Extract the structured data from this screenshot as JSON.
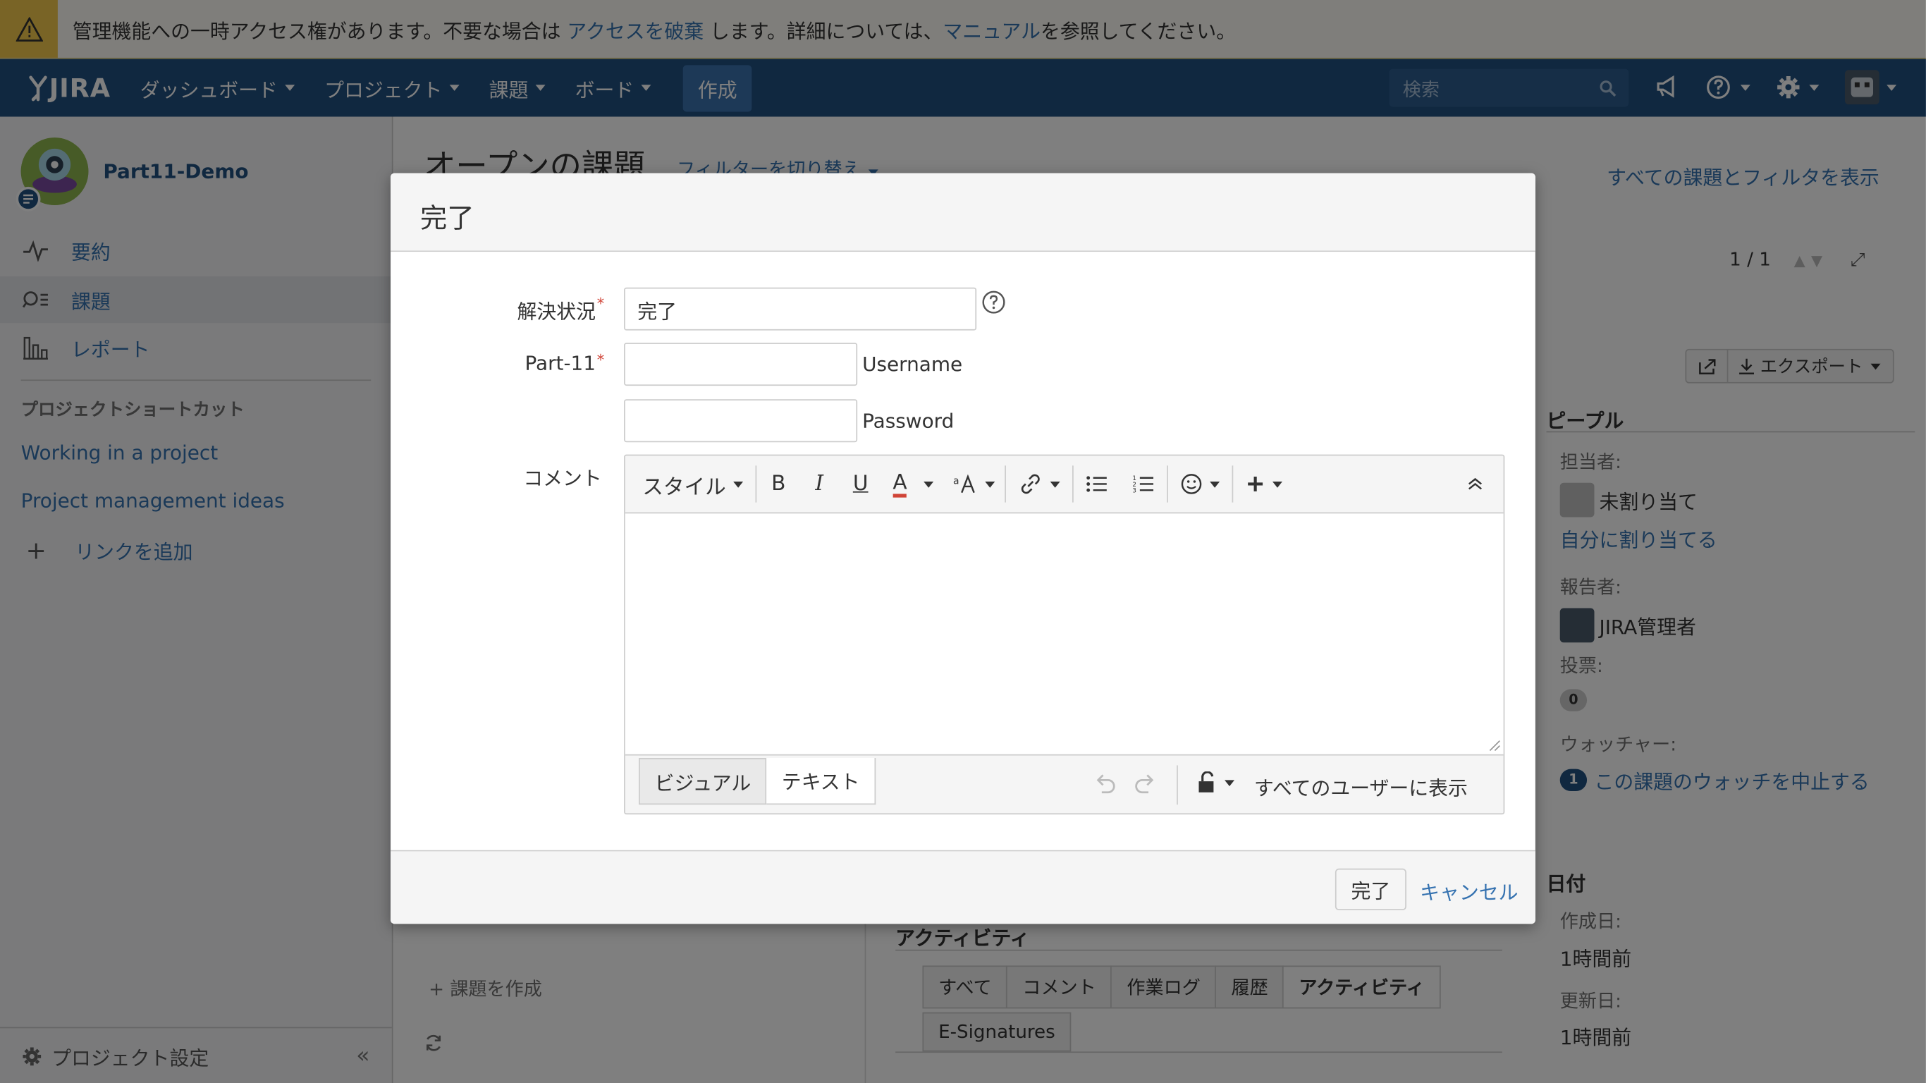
{
  "banner": {
    "text_before": "管理機能への一時アクセス権があります。不要な場合は",
    "revoke_link": "アクセスを破棄",
    "text_middle": "します。詳細については、",
    "manual_link": "マニュアル",
    "text_after": "を参照してください。"
  },
  "topnav": {
    "logo": "JIRA",
    "items": [
      {
        "label": "ダッシュボード"
      },
      {
        "label": "プロジェクト"
      },
      {
        "label": "課題"
      },
      {
        "label": "ボード"
      }
    ],
    "create": "作成",
    "search_placeholder": "検索"
  },
  "sidebar": {
    "project_name": "Part11-Demo",
    "items": [
      {
        "label": "要約",
        "icon": "activity-icon"
      },
      {
        "label": "課題",
        "icon": "issues-icon"
      },
      {
        "label": "レポート",
        "icon": "reports-icon"
      }
    ],
    "shortcuts_heading": "プロジェクトショートカット",
    "shortcuts": [
      {
        "label": "Working in a project"
      },
      {
        "label": "Project management ideas"
      }
    ],
    "add_link": "リンクを追加",
    "settings": "プロジェクト設定"
  },
  "main": {
    "title": "オープンの課題",
    "filter_switch": "フィルターを切り替え",
    "all_link": "すべての課題とフィルタを表示",
    "pager": "1 / 1",
    "export": "エクスポート",
    "people_heading": "ピープル",
    "assignee_label": "担当者:",
    "assignee_value": "未割り当て",
    "assign_to_me": "自分に割り当てる",
    "reporter_label": "報告者:",
    "reporter_value": "JIRA管理者",
    "votes_label": "投票:",
    "votes_count": "0",
    "watchers_label": "ウォッチャー:",
    "watchers_count": "1",
    "stop_watching": "この課題のウォッチを中止する",
    "dates_heading": "日付",
    "created_label": "作成日:",
    "created_value": "1時間前",
    "updated_label": "更新日:",
    "updated_value": "1時間前",
    "activity_heading": "アクティビティ",
    "activity_tabs": [
      "すべて",
      "コメント",
      "作業ログ",
      "履歴",
      "アクティビティ"
    ],
    "esig_tab": "E-Signatures",
    "create_issue": "+ 課題を作成"
  },
  "dialog": {
    "title": "完了",
    "resolution_label": "解決状況",
    "resolution_value": "完了",
    "part11_label": "Part-11",
    "username_label": "Username",
    "password_label": "Password",
    "comment_label": "コメント",
    "toolbar": {
      "style": "スタイル",
      "bold": "B",
      "italic": "I",
      "underline": "U",
      "color": "A"
    },
    "mode_visual": "ビジュアル",
    "mode_text": "テキスト",
    "visibility": "すべてのユーザーに表示",
    "done_button": "完了",
    "cancel_link": "キャンセル"
  }
}
